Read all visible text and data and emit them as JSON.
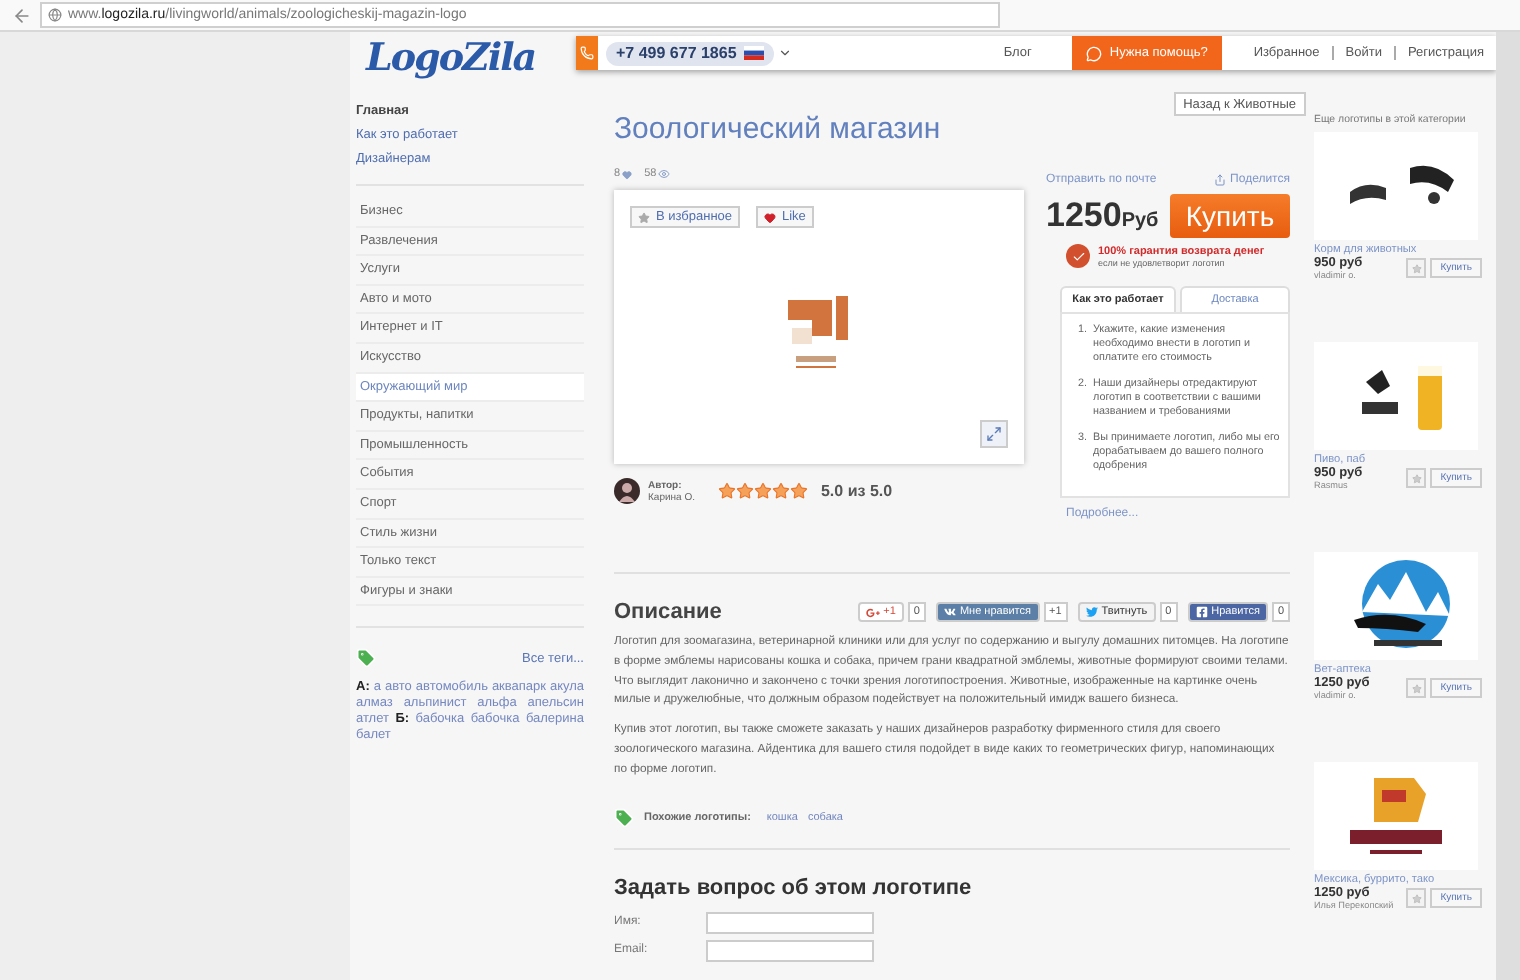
{
  "browser": {
    "url": "www.**logozila.ru**/livingworld/animals/zoologicheskij-magazin-logo"
  },
  "header": {
    "logo": "LogoZila",
    "phone": "+7 499 677 1865",
    "links": [
      "Блог"
    ],
    "help_button": "Нужна помощь?",
    "account_links": [
      "Избранное",
      "Войти",
      "Регистрация"
    ]
  },
  "sidebar": {
    "main_links": [
      {
        "label": "Главная",
        "selected": true
      },
      {
        "label": "Как это работает",
        "selected": false
      },
      {
        "label": "Дизайнерам",
        "selected": false
      }
    ],
    "categories": [
      {
        "label": "Бизнес",
        "selected": false
      },
      {
        "label": "Развлечения",
        "selected": false
      },
      {
        "label": "Услуги",
        "selected": false
      },
      {
        "label": "Авто и мото",
        "selected": false
      },
      {
        "label": "Интернет и IT",
        "selected": false
      },
      {
        "label": "Искусство",
        "selected": false
      },
      {
        "label": "Окружающий мир",
        "selected": true
      },
      {
        "label": "Продукты, напитки",
        "selected": false
      },
      {
        "label": "Промышленность",
        "selected": false
      },
      {
        "label": "События",
        "selected": false
      },
      {
        "label": "Спорт",
        "selected": false
      },
      {
        "label": "Стиль жизни",
        "selected": false
      },
      {
        "label": "Только текст",
        "selected": false
      },
      {
        "label": "Фигуры и знаки",
        "selected": false
      }
    ],
    "all_tags_link": "Все теги...",
    "tags": [
      {
        "letter": "А:",
        "words": [
          "а",
          "авто",
          "автомобиль",
          "аквапарк",
          "акула",
          "алмаз",
          "альпинист",
          "альфа",
          "апельсин",
          "атлет"
        ]
      },
      {
        "letter": "Б:",
        "words": [
          "бабочка",
          "бабочка",
          "балерина",
          "балет"
        ]
      }
    ]
  },
  "product": {
    "back_button": "Назад к Животные",
    "title": "Зоологический магазин",
    "likes": "8",
    "views": "58",
    "favorite_button": "В избранное",
    "like_button": "Like",
    "author_label": "Автор:",
    "author_name": "Карина О.",
    "stars": 5,
    "rating": "5.0 из 5.0",
    "email_link": "Отправить по почте",
    "share_link": "Поделится",
    "price": "1250",
    "currency": "Руб",
    "buy_button": "Купить",
    "guarantee_title": "100% гарантия возврата денег",
    "guarantee_note": "если не удовлетворит логотип",
    "tabs": [
      {
        "label": "Как это работает",
        "selected": true
      },
      {
        "label": "Доставка",
        "selected": false
      }
    ],
    "steps": [
      {
        "number": "1.",
        "text": "Укажите, какие изменения необходимо внести в логотип и оплатите его стоимость"
      },
      {
        "number": "2.",
        "text": "Наши дизайнеры отредактируют логотип в соответствии с вашими названием и требованиями"
      },
      {
        "number": "3.",
        "text": "Вы принимаете логотип, либо мы его дорабатываем до вашего полного одобрения"
      }
    ],
    "more_link": "Подробнее..."
  },
  "description": {
    "title": "Описание",
    "social": [
      {
        "kind": "gplus",
        "label": "+1",
        "count": "0"
      },
      {
        "kind": "vk",
        "label": "Мне нравится",
        "count": "+1"
      },
      {
        "kind": "twitter",
        "label": "Твитнуть",
        "count": "0"
      },
      {
        "kind": "facebook",
        "label": "Нравится",
        "count": "0"
      }
    ],
    "paragraphs": [
      "Логотип для зоомагазина, ветеринарной клиники или для услуг по содержанию и выгулу домашних питомцев. На логотипе в форме эмблемы нарисованы кошка и собака, причем грани квадратной эмблемы, животные формируют своими телами. Что выглядит лаконично и закончено с точки зрения логотипостроения. Животные, изображенные на картинке очень милые и дружелюбные, что должным образом подействует на положительный имидж вашего бизнеса.",
      "Купив этот логотип, вы также сможете заказать у наших дизайнеров разработку фирменного стиля для своего зоологического магазина. Айдентика для вашего стиля подойдет в виде каких то геометрических фигур, напоминающих по форме логотип."
    ],
    "similar_label": "Похожие логотипы:",
    "similar_tags": [
      "кошка",
      "собака"
    ]
  },
  "question_form": {
    "title": "Задать вопрос об этом логотипе",
    "fields": [
      {
        "label": "Имя:"
      },
      {
        "label": "Email:"
      }
    ]
  },
  "related": {
    "title": "Еще логотипы в этой категории",
    "items": [
      {
        "kind": "collar",
        "name": "Корм для животных",
        "price": "950 руб",
        "author": "vladimir o.",
        "buy_button": "Купить"
      },
      {
        "kind": "beer",
        "name": "Пиво, паб",
        "price": "950 руб",
        "author": "Rasmus",
        "buy_button": "Купить"
      },
      {
        "kind": "mountain",
        "name": "Вет-аптека",
        "price": "1250 руб",
        "author": "vladimir o.",
        "buy_button": "Купить"
      },
      {
        "kind": "mask",
        "name": "Мексика, буррито, тако",
        "price": "1250 руб",
        "author": "Илья Перекопский",
        "buy_button": "Купить"
      }
    ]
  }
}
